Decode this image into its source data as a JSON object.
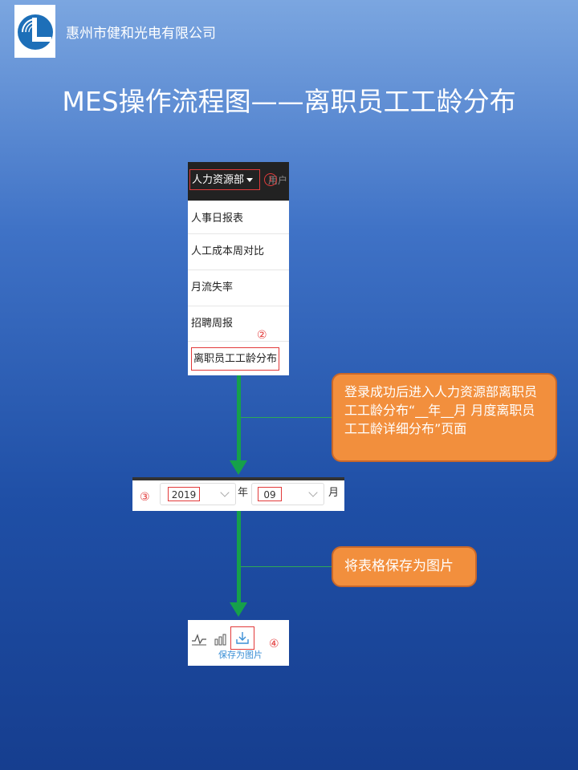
{
  "header": {
    "company": "惠州市健和光电有限公司",
    "title": "MES操作流程图——离职员工工龄分布"
  },
  "menu": {
    "department": "人力资源部",
    "users_tab": "用户",
    "step1": "①",
    "items": [
      "人事日报表",
      "人工成本周对比",
      "月流失率",
      "招聘周报",
      "离职员工工龄分布"
    ],
    "step2": "②"
  },
  "callout1": "登录成功后进入人力资源部离职员工工龄分布“__年__月 月度离职员工工龄详细分布”页面",
  "date_filter": {
    "step3": "③",
    "year": "2019",
    "year_unit": "年",
    "month": "09",
    "month_unit": "月"
  },
  "callout2": "将表格保存为图片",
  "toolbar": {
    "save_label": "保存为图片",
    "step4": "④",
    "icons": [
      "line-chart-icon",
      "bar-chart-icon",
      "download-icon"
    ]
  },
  "colors": {
    "arrow": "#16a04a",
    "callout": "#f28f3d",
    "highlight": "#e23a3a"
  }
}
